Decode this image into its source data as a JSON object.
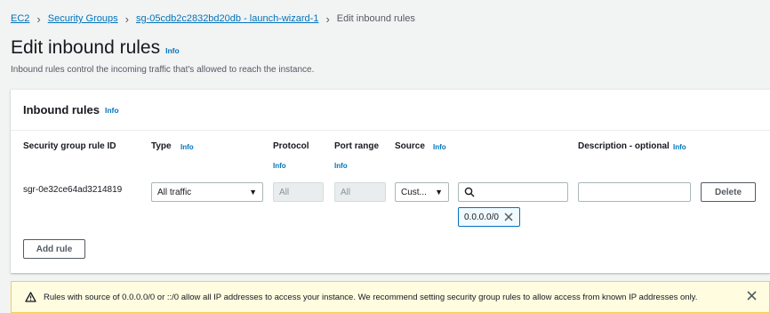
{
  "breadcrumb": {
    "items": [
      "EC2",
      "Security Groups",
      "sg-05cdb2c2832bd20db - launch-wizard-1"
    ],
    "current": "Edit inbound rules"
  },
  "page": {
    "title": "Edit inbound rules",
    "info": "Info",
    "subtitle": "Inbound rules control the incoming traffic that's allowed to reach the instance."
  },
  "panel": {
    "title": "Inbound rules",
    "info": "Info"
  },
  "columns": {
    "rule_id": "Security group rule ID",
    "type": "Type",
    "type_info": "Info",
    "protocol": "Protocol",
    "protocol_info": "Info",
    "port_range": "Port range",
    "port_info": "Info",
    "source": "Source",
    "source_info": "Info",
    "description": "Description - optional",
    "description_info": "Info"
  },
  "rule": {
    "id": "sgr-0e32ce64ad3214819",
    "type": "All traffic",
    "protocol": "All",
    "port_range": "All",
    "source_type": "Cust...",
    "source_search_value": "",
    "source_token": "0.0.0.0/0",
    "description": "",
    "delete_label": "Delete"
  },
  "actions": {
    "add_rule": "Add rule"
  },
  "alert": {
    "text": "Rules with source of 0.0.0.0/0 or ::/0 allow all IP addresses to access your instance. We recommend setting security group rules to allow access from known IP addresses only.",
    "color": "#f5ce57"
  }
}
